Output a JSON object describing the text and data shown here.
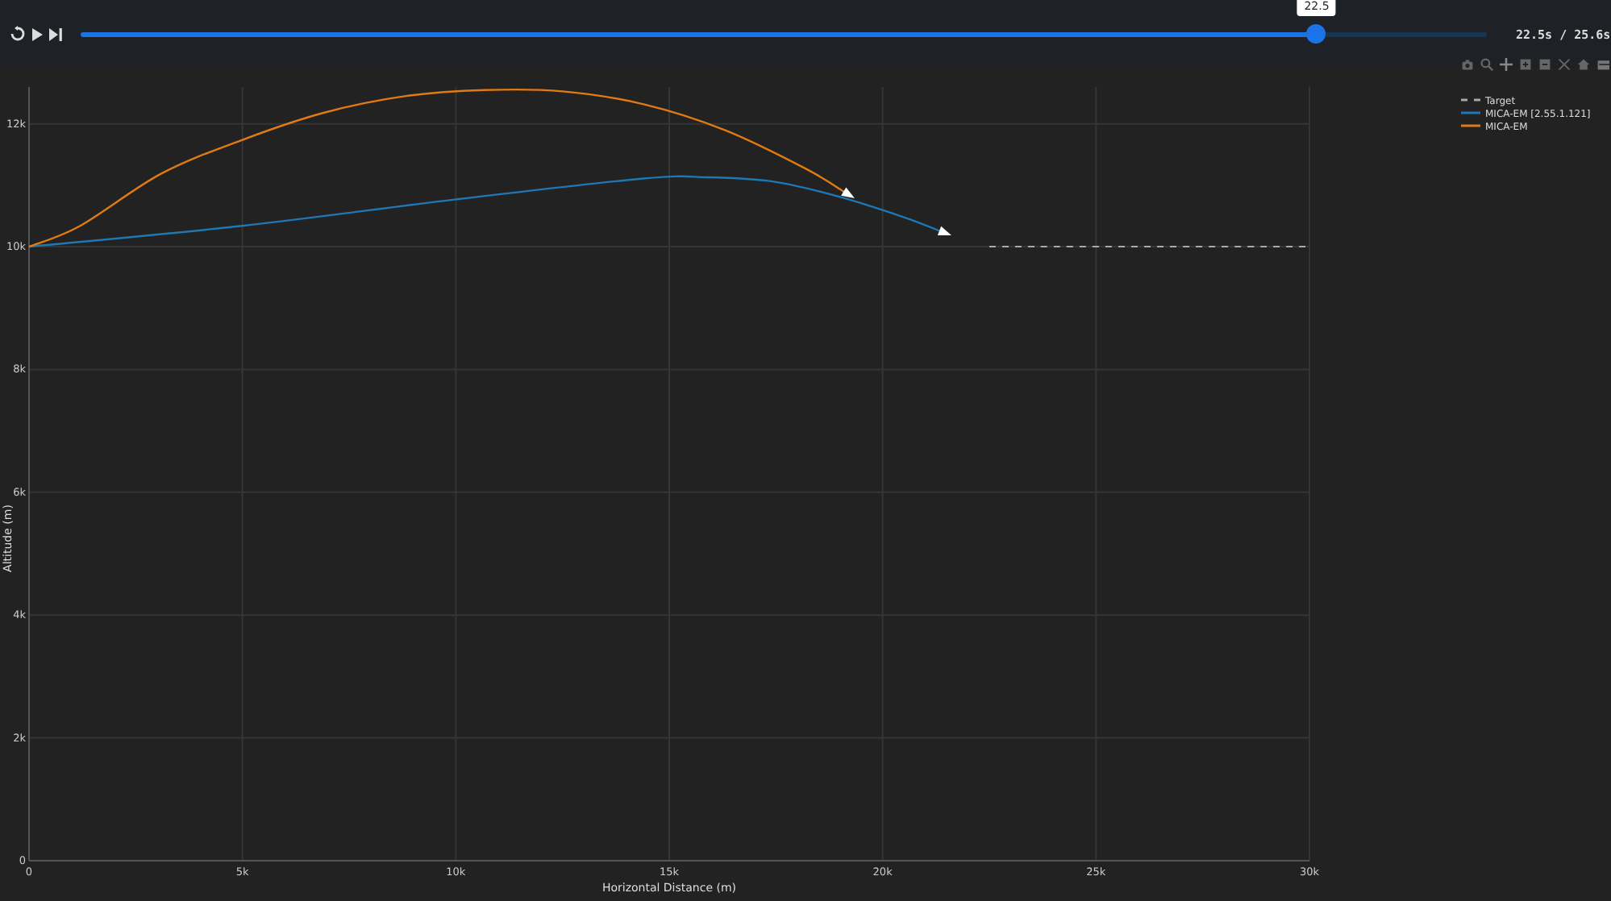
{
  "player": {
    "slider": {
      "level": 0.879,
      "tooltip": "22.5"
    },
    "time_reading": "22.5s / 25.6s"
  },
  "chart": {
    "chart_data": {
      "type": "line",
      "xlabel": "Horizontal Distance (m)",
      "ylabel": "Altitude (m)",
      "xlim": [
        0,
        30000
      ],
      "ylim": [
        0,
        12600
      ],
      "grid": true,
      "legend": true,
      "xticks": [
        {
          "value": 0,
          "label": "0"
        },
        {
          "value": 5000,
          "label": "5k"
        },
        {
          "value": 10000,
          "label": "10k"
        },
        {
          "value": 15000,
          "label": "15k"
        },
        {
          "value": 20000,
          "label": "20k"
        },
        {
          "value": 25000,
          "label": "25k"
        },
        {
          "value": 30000,
          "label": "30k"
        }
      ],
      "yticks": [
        {
          "value": 0,
          "label": "0"
        },
        {
          "value": 2000,
          "label": "2k"
        },
        {
          "value": 4000,
          "label": "4k"
        },
        {
          "value": 6000,
          "label": "6k"
        },
        {
          "value": 8000,
          "label": "8k"
        },
        {
          "value": 10000,
          "label": "10k"
        },
        {
          "value": 12000,
          "label": "12k"
        }
      ],
      "series": [
        {
          "name": "Target",
          "color": "#aaaaaa",
          "line_style": "dash",
          "x": [
            22500,
            30000
          ],
          "values": [
            10000,
            10000
          ]
        },
        {
          "name": "MICA-EM [2.55.1.121]",
          "color": "#1f77b4",
          "line_style": "solid",
          "x": [
            0,
            5000,
            10000,
            14400,
            15900,
            17450,
            18950,
            20500,
            21400
          ],
          "values": [
            10000,
            10340,
            10770,
            11110,
            11130,
            11060,
            10820,
            10480,
            10240
          ]
        },
        {
          "name": "MICA-EM",
          "color": "#e07b14",
          "line_style": "solid",
          "x": [
            0,
            1200,
            3100,
            5000,
            6900,
            8800,
            10650,
            12500,
            14400,
            16300,
            18200,
            19150
          ],
          "values": [
            10000,
            10340,
            11190,
            11740,
            12180,
            12450,
            12550,
            12530,
            12320,
            11900,
            11270,
            10870
          ]
        }
      ]
    }
  }
}
